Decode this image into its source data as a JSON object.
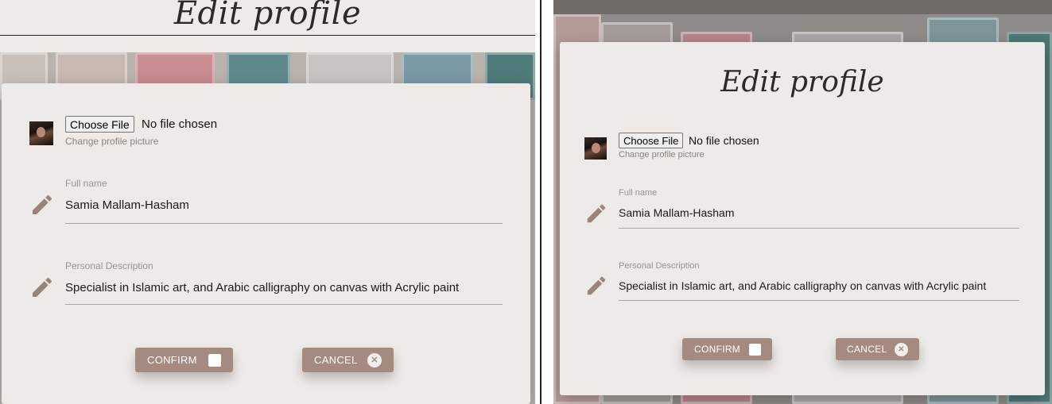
{
  "profile": {
    "title": "Edit profile",
    "file_button": "Choose File",
    "file_status": "No file chosen",
    "change_picture_hint": "Change profile picture",
    "full_name_label": "Full name",
    "full_name_value": "Samia Mallam-Hasham",
    "description_label": "Personal Description",
    "description_value": "Specialist in Islamic art, and Arabic calligraphy on canvas with Acrylic paint",
    "confirm_label": "CONFIRM",
    "cancel_label": "CANCEL"
  },
  "icons": {
    "pencil": "pencil-icon",
    "confirm": "checkbox-icon",
    "cancel": "close-circle-icon"
  },
  "colors": {
    "card_bg": "#eeeae7",
    "button_bg": "#a58b7f",
    "label": "#9a9390",
    "pencil": "#9b857b"
  }
}
